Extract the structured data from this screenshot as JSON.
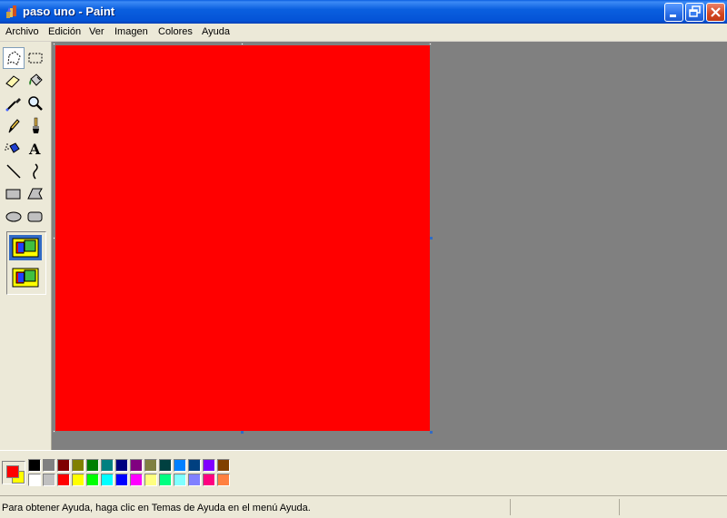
{
  "window": {
    "title": "paso uno - Paint",
    "icons": {
      "app": "paint-brush-icon",
      "minimize": "minimize-icon",
      "restore": "restore-icon",
      "close": "close-icon"
    }
  },
  "menu": [
    "Archivo",
    "Edición",
    "Ver",
    "Imagen",
    "Colores",
    "Ayuda"
  ],
  "toolbox": {
    "tools": [
      {
        "name": "free-form-select",
        "icon": "free-form-select-icon"
      },
      {
        "name": "rect-select",
        "icon": "rect-select-icon"
      },
      {
        "name": "eraser",
        "icon": "eraser-icon"
      },
      {
        "name": "fill",
        "icon": "fill-bucket-icon"
      },
      {
        "name": "pick-color",
        "icon": "eyedropper-icon"
      },
      {
        "name": "magnifier",
        "icon": "magnifier-icon"
      },
      {
        "name": "pencil",
        "icon": "pencil-icon"
      },
      {
        "name": "brush",
        "icon": "brush-icon"
      },
      {
        "name": "airbrush",
        "icon": "airbrush-icon"
      },
      {
        "name": "text",
        "icon": "text-icon",
        "glyph": "A"
      },
      {
        "name": "line",
        "icon": "line-icon"
      },
      {
        "name": "curve",
        "icon": "curve-icon"
      },
      {
        "name": "rectangle",
        "icon": "rectangle-icon"
      },
      {
        "name": "polygon",
        "icon": "polygon-icon"
      },
      {
        "name": "ellipse",
        "icon": "ellipse-icon"
      },
      {
        "name": "rounded-rectangle",
        "icon": "rounded-rectangle-icon"
      }
    ],
    "selected_tool": "free-form-select",
    "options": [
      "opaque-selection-icon",
      "transparent-selection-icon"
    ],
    "selected_option": 0
  },
  "canvas": {
    "color": "#ff0000",
    "workspace_color": "#808080"
  },
  "colors": {
    "foreground": "#ff0000",
    "background": "#ffff00",
    "palette_top": [
      "#000000",
      "#808080",
      "#800000",
      "#808000",
      "#008000",
      "#008080",
      "#000080",
      "#800080",
      "#808040",
      "#004040",
      "#0080ff",
      "#004080",
      "#8000ff",
      "#804000"
    ],
    "palette_bottom": [
      "#ffffff",
      "#c0c0c0",
      "#ff0000",
      "#ffff00",
      "#00ff00",
      "#00ffff",
      "#0000ff",
      "#ff00ff",
      "#ffff80",
      "#00ff80",
      "#80ffff",
      "#8080ff",
      "#ff0080",
      "#ff8040"
    ]
  },
  "status": {
    "text": "Para obtener Ayuda, haga clic en Temas de Ayuda en el menú Ayuda."
  }
}
